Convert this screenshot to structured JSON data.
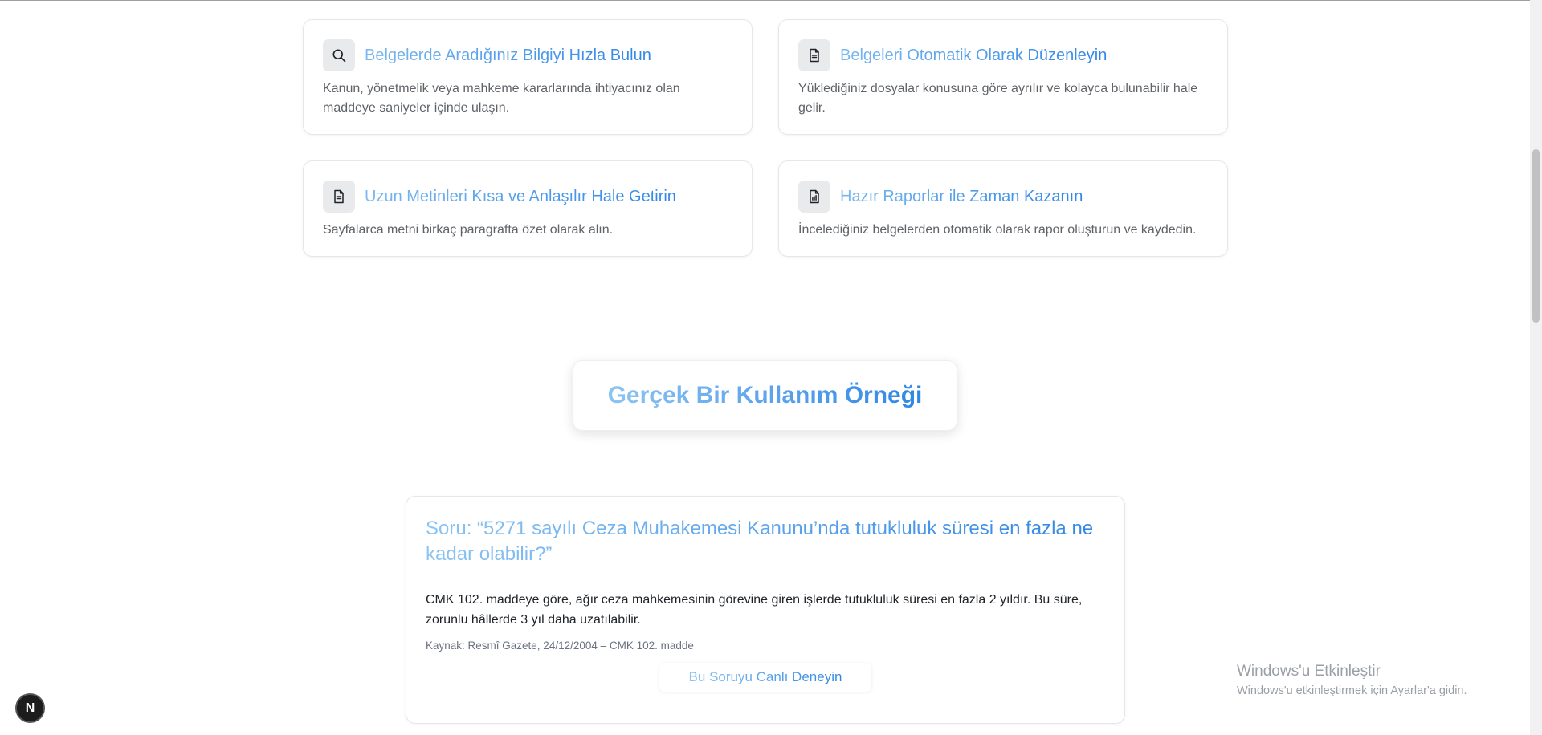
{
  "features": [
    {
      "icon": "search-icon",
      "title": "Belgelerde Aradığınız Bilgiyi Hızla Bulun",
      "description": "Kanun, yönetmelik veya mahkeme kararlarında ihtiyacınız olan maddeye saniyeler içinde ulaşın."
    },
    {
      "icon": "document-icon",
      "title": "Belgeleri Otomatik Olarak Düzenleyin",
      "description": "Yüklediğiniz dosyalar konusuna göre ayrılır ve kolayca bulunabilir hale gelir."
    },
    {
      "icon": "document-icon",
      "title": "Uzun Metinleri Kısa ve Anlaşılır Hale Getirin",
      "description": "Sayfalarca metni birkaç paragrafta özet olarak alın."
    },
    {
      "icon": "report-chart-icon",
      "title": "Hazır Raporlar ile Zaman Kazanın",
      "description": "İncelediğiniz belgelerden otomatik olarak rapor oluşturun ve kaydedin."
    }
  ],
  "section": {
    "title": "Gerçek Bir Kullanım Örneği"
  },
  "example": {
    "question": "Soru: “5271 sayılı Ceza Muhakemesi Kanunu’nda tutukluluk süresi en fazla ne kadar olabilir?”",
    "answer": "CMK 102. maddeye göre, ağır ceza mahkemesinin görevine giren işlerde tutukluluk süresi en fazla 2 yıldır. Bu süre, zorunlu hâllerde 3 yıl daha uzatılabilir.",
    "source": "Kaynak: Resmî Gazete, 24/12/2004 – CMK 102. madde",
    "button_label": "Bu Soruyu Canlı Deneyin"
  },
  "badge": {
    "letter": "N"
  },
  "watermark": {
    "title": "Windows'u Etkinleştir",
    "subtitle": "Windows'u etkinleştirmek için Ayarlar'a gidin."
  },
  "colors": {
    "accent_start": "#7ab8ef",
    "accent_end": "#2f86e6",
    "body_text": "#5f6368"
  }
}
